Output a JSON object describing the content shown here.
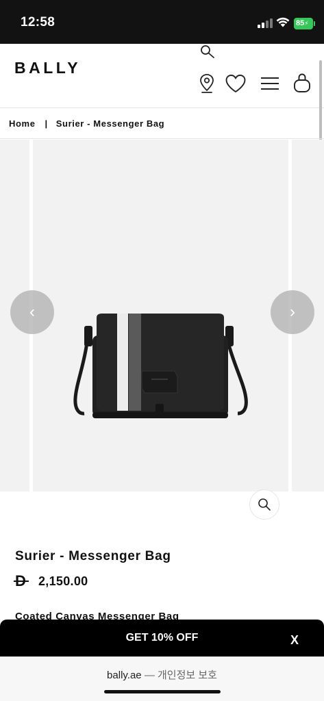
{
  "status_bar": {
    "time": "12:58",
    "battery_level": "85"
  },
  "header": {
    "logo": "BALLY",
    "icons": [
      "search-icon",
      "store-locator-icon",
      "heart-icon",
      "menu-icon",
      "bag-icon"
    ]
  },
  "breadcrumb": {
    "home": "Home",
    "separator": "|",
    "current": "Surier - Messenger Bag"
  },
  "gallery": {
    "prev_symbol": "‹",
    "next_symbol": "›"
  },
  "product": {
    "name": "Surier - Messenger Bag",
    "currency_symbol": "D",
    "price": "2,150.00",
    "subtitle": "Coated Canvas Messenger Bag"
  },
  "promo": {
    "label": "GET 10% OFF",
    "close_label": "X"
  },
  "browser": {
    "domain": "bally.ae",
    "suffix": "— 개인정보 보호"
  }
}
